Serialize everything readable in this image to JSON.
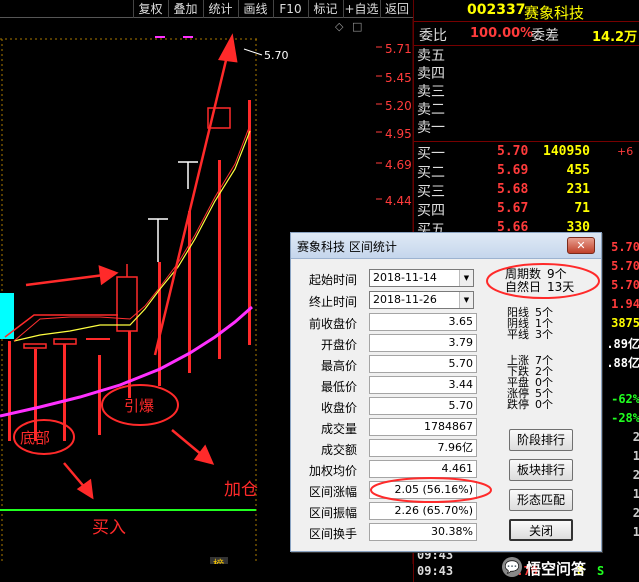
{
  "toolbar": {
    "buttons": [
      "复权",
      "叠加",
      "统计",
      "画线",
      "F10",
      "标记",
      "+自选",
      "返回"
    ],
    "right_icons": [
      "◇",
      "□"
    ]
  },
  "price_axis": {
    "labels": [
      "5.71",
      "5.45",
      "5.20",
      "4.95",
      "4.69",
      "4.44"
    ],
    "high_marker": "5.70"
  },
  "chart": {
    "bottom_tag": "榜",
    "annotations": {
      "bottom": "底部",
      "ignite": "引爆",
      "add": "加仓",
      "buy": "买入"
    }
  },
  "stock": {
    "code": "002337",
    "name": "赛象科技",
    "webi_label": "委比",
    "webi_value": "100.00%",
    "weicha_label": "委差",
    "weicha_value": "14.2万"
  },
  "orderbook": {
    "sells": [
      "卖五",
      "卖四",
      "卖三",
      "卖二",
      "卖一"
    ],
    "buys": [
      {
        "label": "买一",
        "price": "5.70",
        "vol": "140950",
        "chg": "+6"
      },
      {
        "label": "买二",
        "price": "5.69",
        "vol": "455",
        "chg": ""
      },
      {
        "label": "买三",
        "price": "5.68",
        "vol": "231",
        "chg": ""
      },
      {
        "label": "买四",
        "price": "5.67",
        "vol": "71",
        "chg": ""
      },
      {
        "label": "买五",
        "price": "5.66",
        "vol": "330",
        "chg": ""
      }
    ]
  },
  "right_edge": {
    "values": [
      "5.70",
      "5.70",
      "5.70",
      "1.94",
      "3875",
      ".89亿",
      ".88亿",
      "-62%",
      "-28%",
      "2",
      "1",
      "2",
      "1",
      "2",
      "1",
      "2"
    ]
  },
  "ticks": [
    {
      "time": "09:43",
      "price": "",
      "vol": "",
      "flag": ""
    },
    {
      "time": "09:43",
      "price": "5.70",
      "vol": "8",
      "flag": "S"
    }
  ],
  "watermark": "悟空问答",
  "dialog": {
    "title": "赛象科技 区间统计",
    "close": "✕",
    "start_label": "起始时间",
    "start_value": "2018-11-14",
    "end_label": "终止时间",
    "end_value": "2018-11-26",
    "rows": [
      {
        "label": "前收盘价",
        "value": "3.65"
      },
      {
        "label": "开盘价",
        "value": "3.79"
      },
      {
        "label": "最高价",
        "value": "5.70"
      },
      {
        "label": "最低价",
        "value": "3.44"
      },
      {
        "label": "收盘价",
        "value": "5.70"
      },
      {
        "label": "成交量",
        "value": "1784867"
      },
      {
        "label": "成交额",
        "value": "7.96亿"
      },
      {
        "label": "加权均价",
        "value": "4.461"
      },
      {
        "label": "区间涨幅",
        "value": "2.05 (56.16%)"
      },
      {
        "label": "区间振幅",
        "value": "2.26 (65.70%)"
      },
      {
        "label": "区间换手",
        "value": "30.38%"
      }
    ],
    "period": {
      "label": "周期数",
      "value": "9个"
    },
    "natural": {
      "label": "自然日",
      "value": "13天"
    },
    "stats": [
      {
        "label": "阳线",
        "value": "5个"
      },
      {
        "label": "阴线",
        "value": "1个"
      },
      {
        "label": "平线",
        "value": "3个"
      },
      {
        "label": "上涨",
        "value": "7个"
      },
      {
        "label": "下跌",
        "value": "2个"
      },
      {
        "label": "平盘",
        "value": "0个"
      },
      {
        "label": "涨停",
        "value": "5个"
      },
      {
        "label": "跌停",
        "value": "0个"
      }
    ],
    "buttons": [
      "阶段排行",
      "板块排行",
      "形态匹配",
      "关闭"
    ]
  },
  "colors": {
    "up": "#ff2a2a",
    "ma_yellow": "#ffff40",
    "ma_magenta": "#ff30ff",
    "buy_line": "#20ff20",
    "annotation": "#ff2a2a",
    "accent_cyan": "#00ffff"
  }
}
